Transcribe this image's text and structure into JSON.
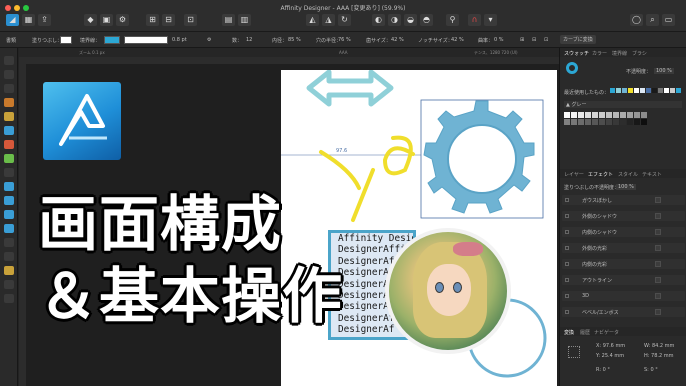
{
  "window": {
    "title": "Affinity Designer - AAA [変更あり] (59.9%)"
  },
  "context_toolbar": {
    "doc_label": "書類",
    "fill_label": "塗りつぶし：",
    "stroke_label": "境界線：",
    "stroke_value": "0.8 pt",
    "count_label": "数：",
    "count_value": "12",
    "inner_label": "内径：",
    "inner_value": "85 %",
    "hole_label": "穴の半径：",
    "hole_value": "76 %",
    "tooth_label": "歯サイズ：",
    "tooth_value": "42 %",
    "notch_label": "ノッチサイズ：",
    "notch_value": "42 %",
    "curve_label": "曲率：",
    "curve_value": "0 %",
    "convert_button": "カーブに変換",
    "accent_color": "#2ca7d4"
  },
  "canvas": {
    "tab_left": "ズーム 0.1 px",
    "tab_mid": "AAA",
    "tab_right": "テンス、1280 720 (UI)",
    "measure": "97.6",
    "text_lines": [
      "Affinity Designer",
      "DesignerAffinity",
      "DesignerAf",
      "DesignerA",
      "DesignerA",
      "DesignerA",
      "DesignerA",
      "DesignerAf",
      "DesignerAf"
    ]
  },
  "right_panel": {
    "top_tabs": [
      "スウォッチ",
      "カラー",
      "境界線",
      "ブラシ"
    ],
    "opacity_label": "不透明度：",
    "opacity_value": "100 %",
    "recent_label": "最近使用したもの：",
    "palette_name": "グレー",
    "fx_tabs": [
      "レイヤー",
      "エフェクト",
      "スタイル",
      "テキスト"
    ],
    "fx_opacity_label": "塗りつぶしの不透明度：",
    "fx_opacity_value": "100 %",
    "effects": [
      "ガウスぼかし",
      "外側のシャドウ",
      "内側のシャドウ",
      "外側の光彩",
      "内側の光彩",
      "アウトライン",
      "3D",
      "ベベル/エンボス"
    ],
    "transform_tabs": [
      "変換",
      "履歴",
      "ナビゲータ"
    ],
    "x_label": "X:",
    "x_value": "97.6 mm",
    "y_label": "Y:",
    "y_value": "25.4 mm",
    "w_label": "W:",
    "w_value": "84.2 mm",
    "h_label": "H:",
    "h_value": "78.2 mm",
    "r_label": "R:",
    "r_value": "0 °",
    "s_label": "S:",
    "s_value": "0 °"
  },
  "overlay": {
    "line1": "画面構成",
    "line2": "＆基本操作"
  },
  "colors": {
    "accent": "#2ca7d4",
    "gear": "#6fb3d3",
    "arrow": "#8fd0d8",
    "scribble": "#f0de2c"
  }
}
